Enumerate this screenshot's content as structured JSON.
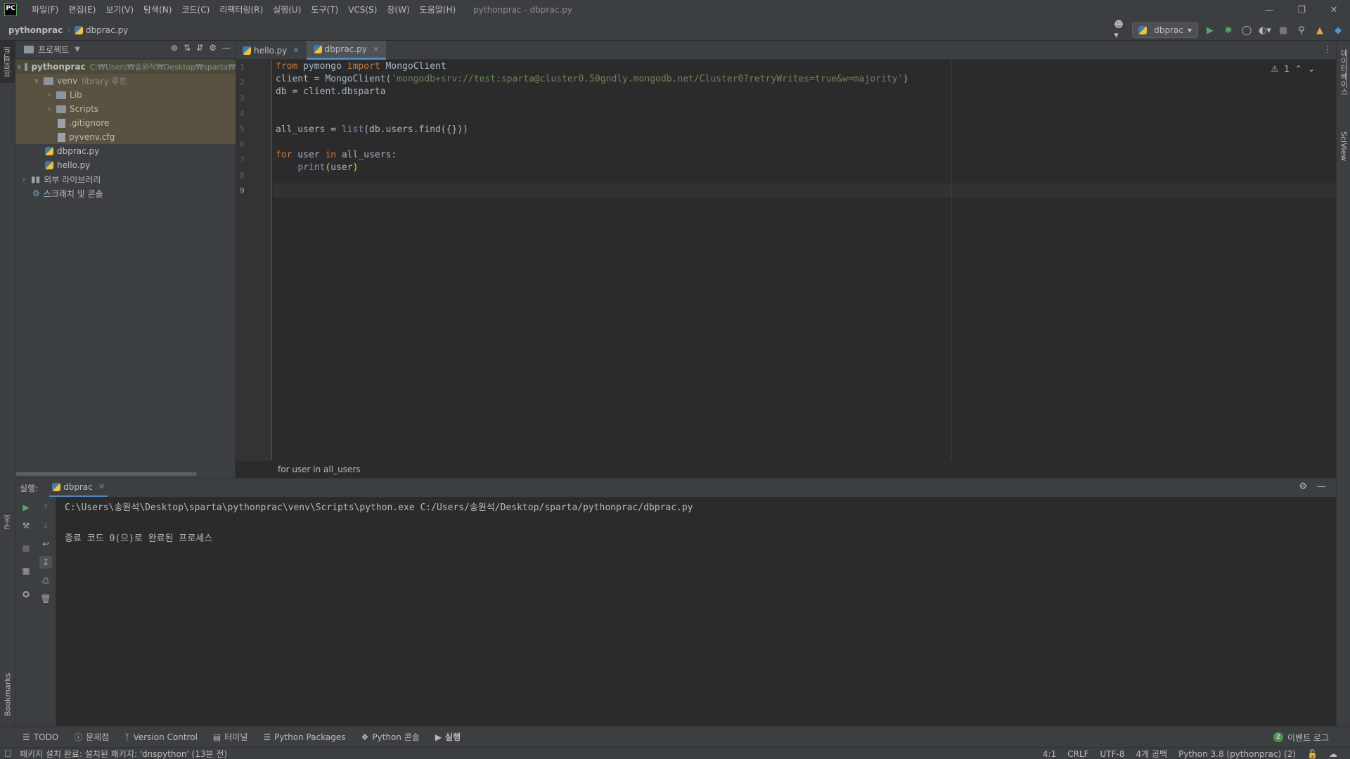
{
  "app": {
    "logo_text": "PC",
    "window_title": "pythonprac - dbprac.py"
  },
  "menu": [
    "파일(F)",
    "편집(E)",
    "보기(V)",
    "탐색(N)",
    "코드(C)",
    "리팩터링(R)",
    "실행(U)",
    "도구(T)",
    "VCS(S)",
    "창(W)",
    "도움말(H)"
  ],
  "navbar": {
    "project": "pythonprac",
    "file": "dbprac.py",
    "run_config": "dbprac"
  },
  "left_stripe": {
    "project_tab": "프로젝트",
    "structure_tab": "구조",
    "bookmarks_tab": "Bookmarks"
  },
  "right_stripe": {
    "database_tab": "데이터베이스",
    "sciview_tab": "SciView"
  },
  "project_panel": {
    "title": "프로젝트",
    "tree": [
      {
        "label": "pythonprac",
        "hint": "C:₩Users₩송원석₩Desktop₩sparta₩",
        "type": "folder",
        "depth": 0,
        "expanded": true,
        "bold": true
      },
      {
        "label": "venv",
        "hint": "library 루트",
        "type": "folder",
        "depth": 1,
        "expanded": true
      },
      {
        "label": "Lib",
        "hint": "",
        "type": "folder",
        "depth": 2,
        "expanded": false
      },
      {
        "label": "Scripts",
        "hint": "",
        "type": "folder",
        "depth": 2,
        "expanded": false
      },
      {
        "label": ".gitignore",
        "hint": "",
        "type": "file",
        "depth": 3
      },
      {
        "label": "pyvenv.cfg",
        "hint": "",
        "type": "file",
        "depth": 3
      },
      {
        "label": "dbprac.py",
        "hint": "",
        "type": "py",
        "depth": 2
      },
      {
        "label": "hello.py",
        "hint": "",
        "type": "py",
        "depth": 2
      },
      {
        "label": "외부 라이브러리",
        "hint": "",
        "type": "lib",
        "depth": 0,
        "expanded": false
      },
      {
        "label": "스크래치 및 콘솔",
        "hint": "",
        "type": "scratch",
        "depth": 1
      }
    ]
  },
  "editor": {
    "tabs": [
      {
        "label": "hello.py",
        "active": false
      },
      {
        "label": "dbprac.py",
        "active": true
      }
    ],
    "line_numbers": [
      "1",
      "2",
      "3",
      "4",
      "5",
      "6",
      "7",
      "8",
      "9"
    ],
    "code": [
      "from pymongo import MongoClient",
      "client = MongoClient('mongodb+srv://test:sparta@cluster0.50gndly.mongodb.net/Cluster0?retryWrites=true&w=majority')",
      "db = client.dbsparta",
      "",
      "",
      "all_users = list(db.users.find({}))",
      "",
      "for user in all_users:",
      "    print(user)"
    ],
    "warning_count": "1",
    "breadcrumb": "for user in all_users"
  },
  "run_panel": {
    "label": "실행:",
    "tab": "dbprac",
    "console": [
      "C:\\Users\\송원석\\Desktop\\sparta\\pythonprac\\venv\\Scripts\\python.exe C:/Users/송원석/Desktop/sparta/pythonprac/dbprac.py",
      "",
      "종료 코드 0(으)로 완료된 프로세스"
    ]
  },
  "tool_windows": [
    {
      "label": "TODO",
      "icon": "list-icon"
    },
    {
      "label": "문제점",
      "icon": "problems-icon"
    },
    {
      "label": "Version Control",
      "icon": "branch-icon"
    },
    {
      "label": "터미널",
      "icon": "terminal-icon"
    },
    {
      "label": "Python Packages",
      "icon": "packages-icon"
    },
    {
      "label": "Python 콘솔",
      "icon": "python-icon"
    },
    {
      "label": "실행",
      "icon": "run-icon"
    }
  ],
  "event_log": {
    "label": "이벤트 로그",
    "count": "2"
  },
  "status_bar": {
    "message": "패키지 설치 완료: 설치된 패키지: 'dnspython' (13분 전)",
    "position": "4:1",
    "line_sep": "CRLF",
    "encoding": "UTF-8",
    "indent": "4개 공백",
    "interpreter": "Python 3.8 (pythonprac) (2)"
  },
  "colors": {
    "background": "#2b2b2b",
    "panel": "#3c3f41",
    "keyword": "#cc7832",
    "string": "#6a8759",
    "builtin": "#8888c6",
    "accent": "#4a88c7"
  }
}
